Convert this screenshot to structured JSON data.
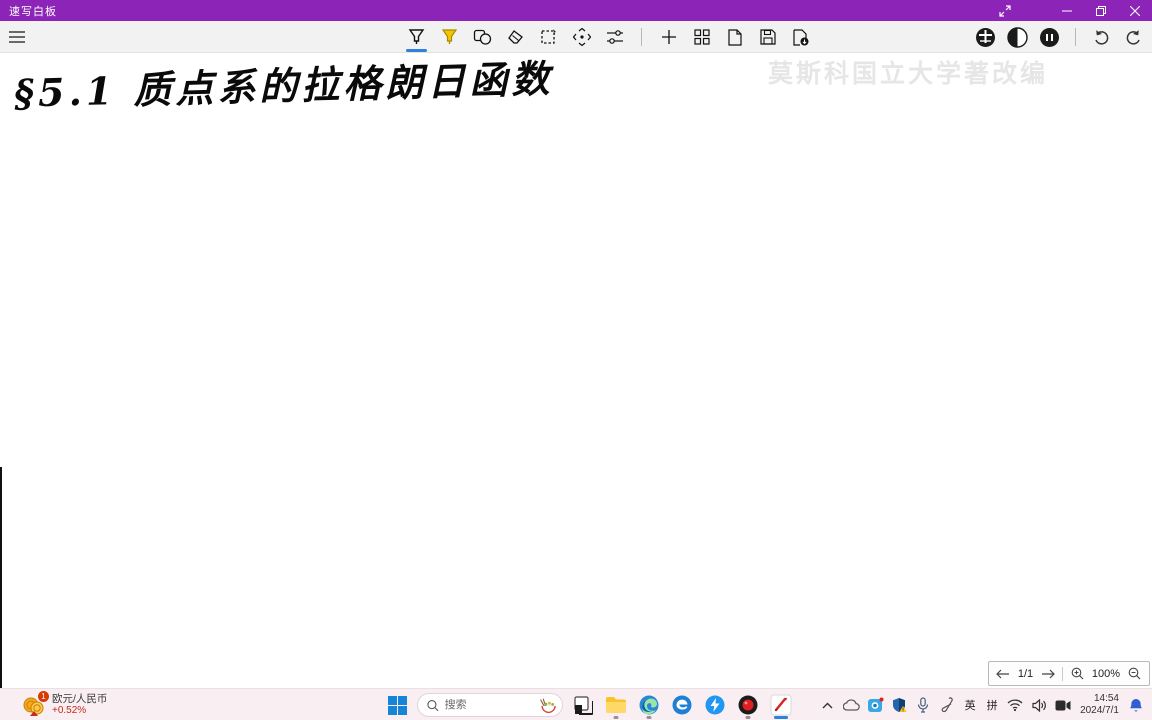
{
  "titlebar": {
    "title": "速写白板",
    "controls": {
      "minimize": "minimize",
      "restore": "restore",
      "close": "close",
      "fullscreen": "toggle-fullscreen"
    }
  },
  "toolbar": {
    "tools": [
      "pen",
      "highlighter",
      "shapes",
      "eraser",
      "select",
      "move",
      "adjust"
    ],
    "actions": [
      "add",
      "board-grid",
      "new-page",
      "save",
      "export"
    ],
    "right_icons": [
      "globe-toggle",
      "contrast-toggle",
      "pause",
      "undo",
      "redo"
    ],
    "selected_tool": "pen"
  },
  "watermark": {
    "text": "莫斯科国立大学著改编"
  },
  "canvas": {
    "handwriting": "§5.1 质点系的拉格朗日函数"
  },
  "page_nav": {
    "page": "1/1",
    "zoom": "100%"
  },
  "taskbar": {
    "widgets": {
      "badge": "1",
      "label": "欧元/人民币",
      "change": "+0.52%"
    },
    "search": {
      "placeholder": "搜索"
    },
    "apps": [
      "start",
      "search",
      "task-view",
      "file-explorer",
      "edge",
      "e-browser",
      "lightning-app",
      "screen-recorder",
      "whiteboard-app"
    ],
    "active_app": "whiteboard-app",
    "tray": {
      "ime_en": "英",
      "ime_pinyin": "拼",
      "time": "14:54",
      "date": "2024/7/1",
      "icons": [
        "hidden-icons-chevron",
        "onedrive",
        "capture-app",
        "security-shield",
        "microphone",
        "stylus",
        "wifi",
        "speaker",
        "video-camera",
        "notification-bell"
      ]
    }
  },
  "colors": {
    "titlebar": "#8c24b8",
    "toolbar_bg": "#f3f2f3",
    "taskbar_bg": "#f9eef2",
    "accent_blue": "#2f80d9",
    "highlighter_yellow": "#f2c500",
    "negative_red": "#c42b1c"
  }
}
